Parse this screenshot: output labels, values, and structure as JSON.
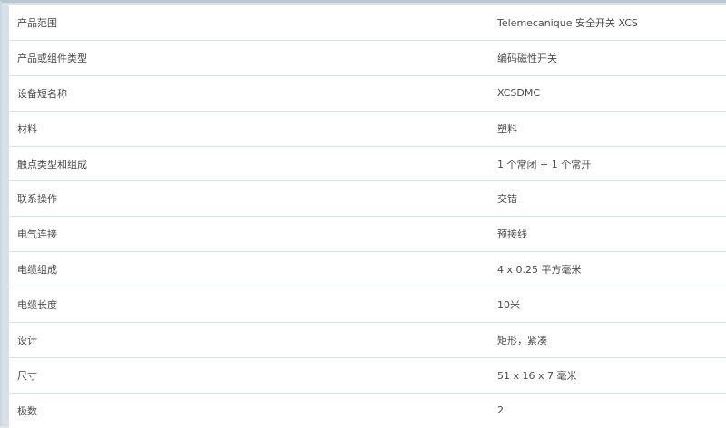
{
  "specs": [
    {
      "label": "产品范围",
      "value": "Telemecanique 安全开关 XCS"
    },
    {
      "label": "产品或组件类型",
      "value": "编码磁性开关"
    },
    {
      "label": "设备短名称",
      "value": "XCSDMC"
    },
    {
      "label": "材料",
      "value": "塑料"
    },
    {
      "label": "触点类型和组成",
      "value": "1 个常闭 + 1 个常开"
    },
    {
      "label": "联系操作",
      "value": "交错"
    },
    {
      "label": "电气连接",
      "value": "预接线"
    },
    {
      "label": "电缆组成",
      "value": "4 x 0.25 平方毫米"
    },
    {
      "label": "电缆长度",
      "value": "10米"
    },
    {
      "label": "设计",
      "value": "矩形，紧凑"
    },
    {
      "label": "尺寸",
      "value": "51 x 16 x 7 毫米"
    },
    {
      "label": "极数",
      "value": "2"
    }
  ]
}
